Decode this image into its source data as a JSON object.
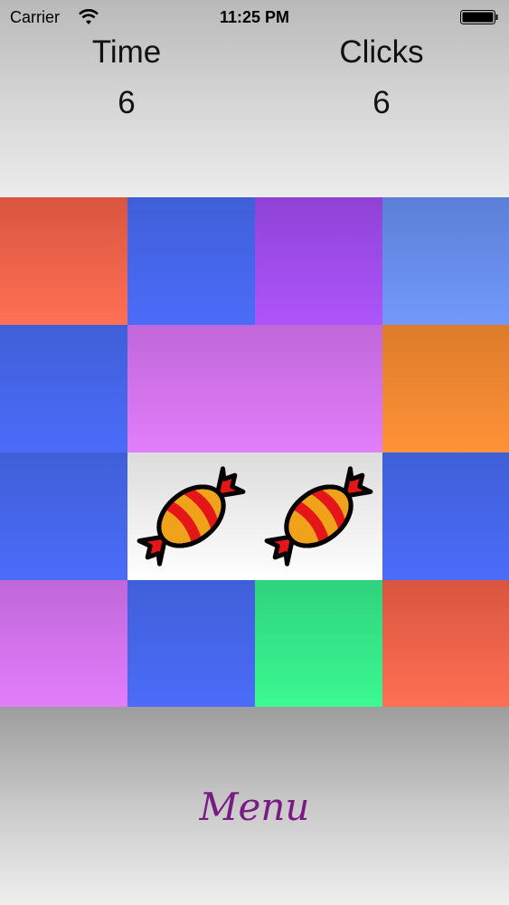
{
  "status_bar": {
    "carrier": "Carrier",
    "time": "11:25 PM"
  },
  "stats": {
    "time_label": "Time",
    "time_value": "6",
    "clicks_label": "Clicks",
    "clicks_value": "6"
  },
  "board": {
    "rows": [
      [
        "red",
        "blue",
        "purple",
        "sky"
      ],
      [
        "blue",
        "pink",
        "pink",
        "orange"
      ],
      [
        "blue",
        "candy",
        "candy",
        "blue"
      ],
      [
        "pink",
        "blue",
        "green",
        "red"
      ]
    ],
    "matched_pairs_shown": "candy",
    "colors": {
      "red": "#ff7055",
      "blue": "#4b6cf9",
      "purple": "#ae55fb",
      "sky": "#7299fb",
      "pink": "#e27efb",
      "orange": "#ff9238",
      "green": "#3bfa93",
      "candy_bg": "#ffffff"
    },
    "icon": "candy-icon"
  },
  "footer": {
    "menu_label": "Menu"
  }
}
